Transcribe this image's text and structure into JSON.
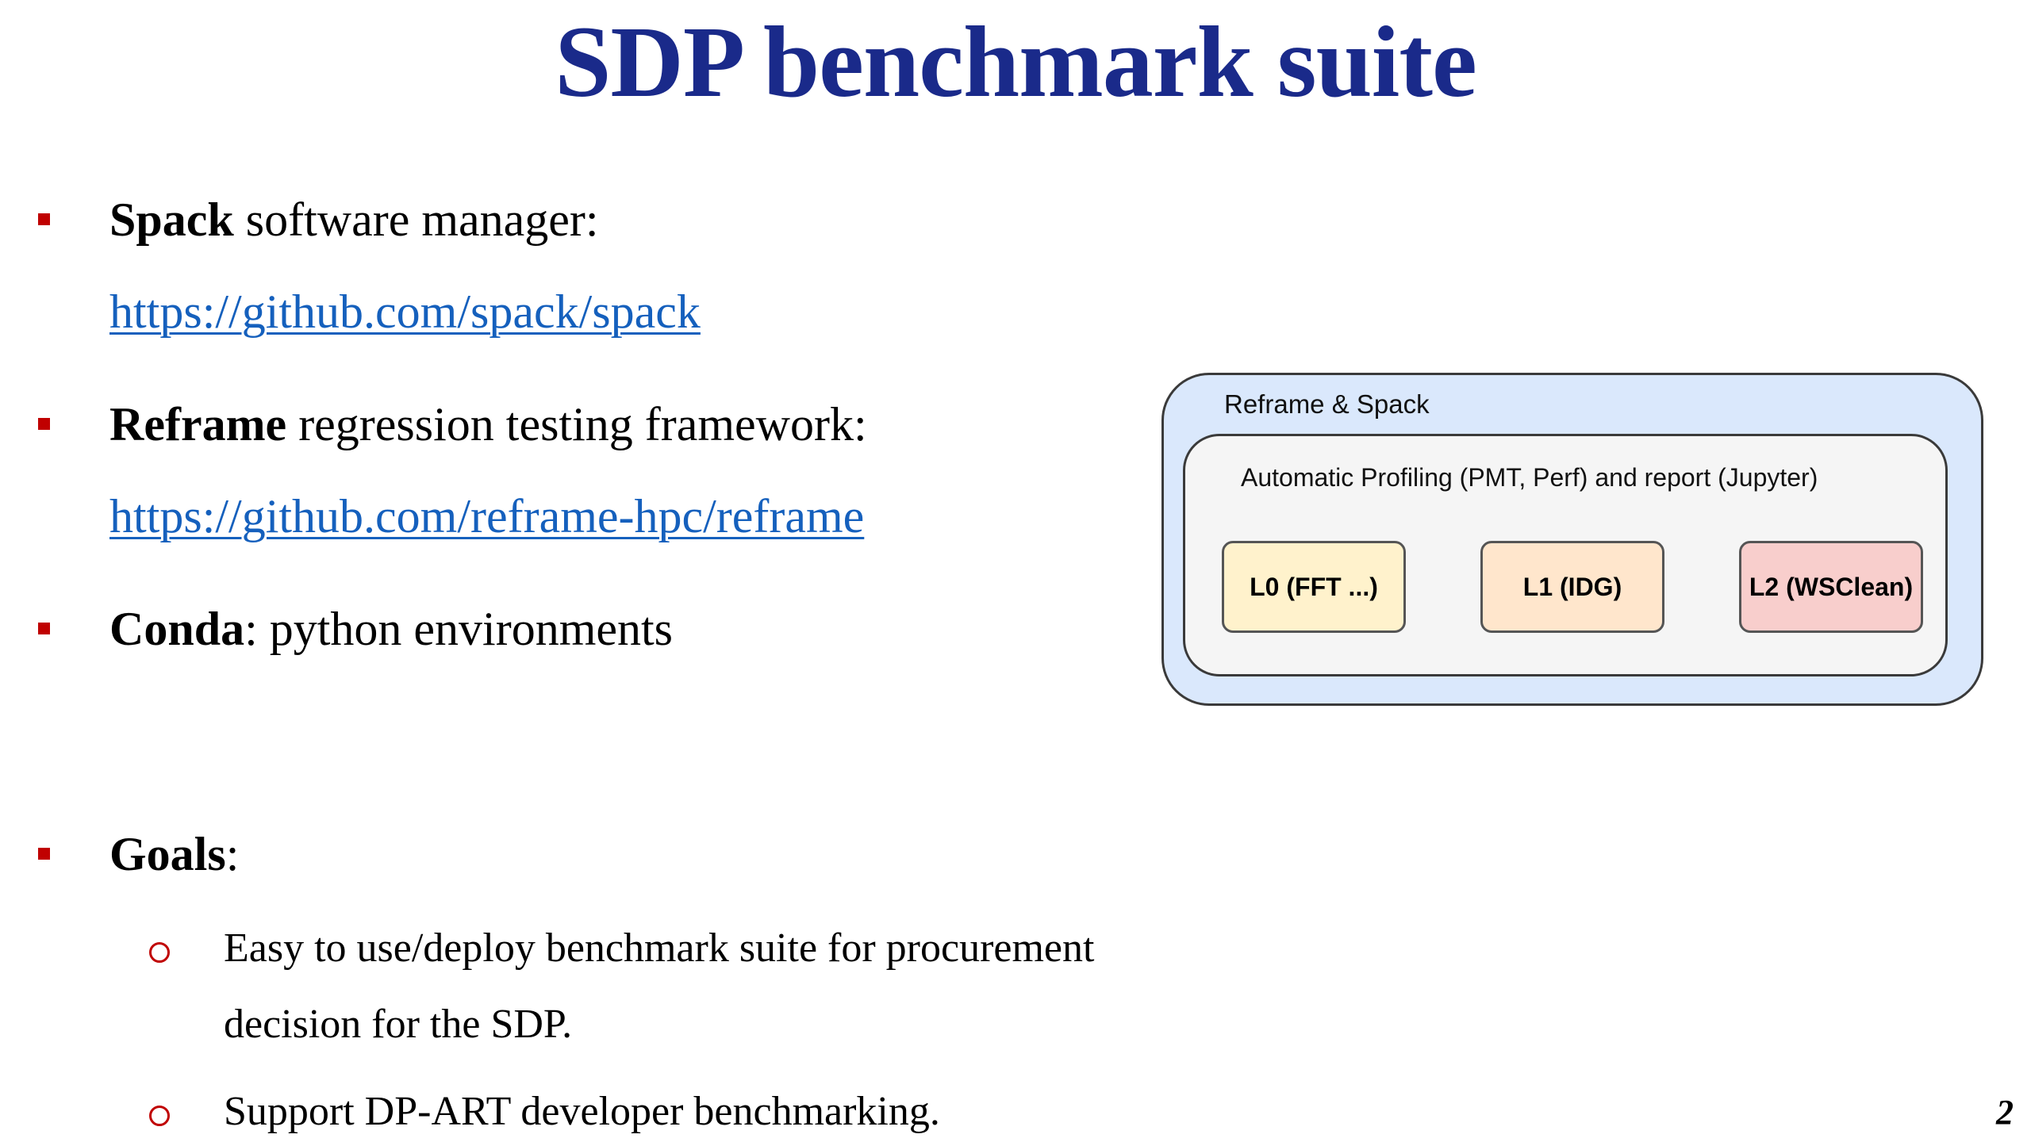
{
  "slide": {
    "title": "SDP benchmark suite",
    "page_number": "2"
  },
  "bullets": [
    {
      "bold": "Spack",
      "rest": " software manager:",
      "link": "https://github.com/spack/spack"
    },
    {
      "bold": "Reframe",
      "rest": " regression testing framework:",
      "link": "https://github.com/reframe-hpc/reframe"
    },
    {
      "bold": "Conda",
      "rest": ": python environments"
    },
    {
      "bold": "Goals",
      "rest": ":",
      "sub": [
        {
          "line1": "Easy to use/deploy benchmark suite for procurement",
          "line2": "decision for the SDP."
        },
        {
          "line1": "Support DP-ART developer benchmarking."
        }
      ]
    }
  ],
  "diagram": {
    "outer_label": "Reframe & Spack",
    "inner_label": "Automatic Profiling (PMT, Perf) and report (Jupyter)",
    "boxes": [
      {
        "label": "L0 (FFT ...)",
        "color": "#fff2cc"
      },
      {
        "label": "L1 (IDG)",
        "color": "#ffe6cc"
      },
      {
        "label": "L2 (WSClean)",
        "color": "#f8cecc"
      }
    ],
    "outer_color": "#dae8fc",
    "inner_color": "#f5f5f5"
  },
  "colors": {
    "title": "#1a2a8a",
    "bullet": "#c00000",
    "link": "#1560bd"
  }
}
